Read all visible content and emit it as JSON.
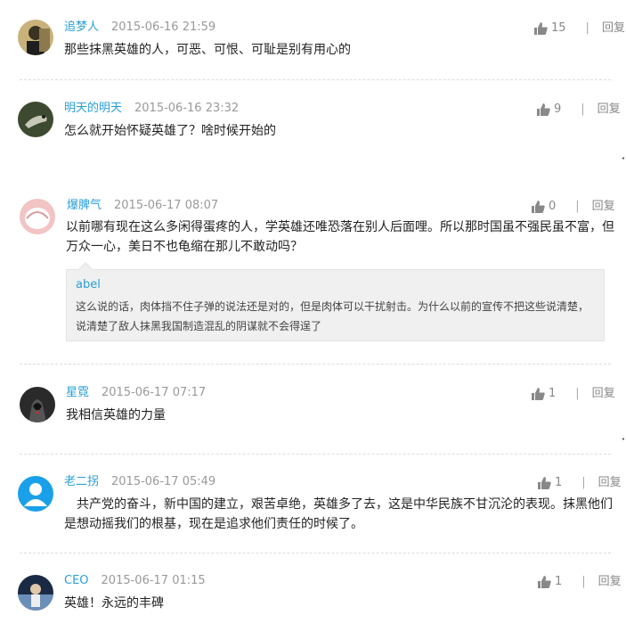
{
  "comments": [
    {
      "user": "追梦人",
      "time": "2015-06-16 21:59",
      "likes": "15",
      "reply": "回复",
      "text": "那些抹黑英雄的人，可恶、可恨、可耻是别有用心的"
    },
    {
      "user": "明天的明天",
      "time": "2015-06-16 23:32",
      "likes": "9",
      "reply": "回复",
      "text": "怎么就开始怀疑英雄了？啥时候开始的"
    },
    {
      "user": "爆脾气",
      "time": "2015-06-17 08:07",
      "likes": "0",
      "reply": "回复",
      "text_line1": "以前哪有现在这么多闲得蛋疼的人，学英雄还唯恐落在别人后面哩。所以那时国虽不强民虽不富，但",
      "text_line2": "万众一心，美日不也龟缩在那儿不敢动吗？",
      "quote": {
        "user": "abel",
        "line1": "这么说的话，肉体挡不住子弹的说法还是对的，但是肉体可以干扰射击。为什么以前的宣传不把这些说清楚，",
        "line2": "说清楚了敌人抹黑我国制造混乱的阴谋就不会得逞了"
      }
    },
    {
      "user": "星霓",
      "time": "2015-06-17 07:17",
      "likes": "1",
      "reply": "回复",
      "text": "我相信英雄的力量"
    },
    {
      "user": "老二拐",
      "time": "2015-06-17 05:49",
      "likes": "1",
      "reply": "回复",
      "text_line1": "　共产党的奋斗，新中国的建立，艰苦卓绝，英雄多了去，这是中华民族不甘沉沦的表现。抹黑他们",
      "text_line2": "是想动摇我们的根基，现在是追求他们责任的时候了。"
    },
    {
      "user": "CEO",
      "time": "2015-06-17 01:15",
      "likes": "1",
      "reply": "回复",
      "text": "英雄！永远的丰碑"
    }
  ],
  "separator": "|",
  "icons": {
    "like": "thumbs-up-icon",
    "default_avatar": "default-user-avatar-icon"
  },
  "colors": {
    "username": "#2a9fd6",
    "time": "#999999",
    "quote_bg": "#f0f0f0"
  }
}
